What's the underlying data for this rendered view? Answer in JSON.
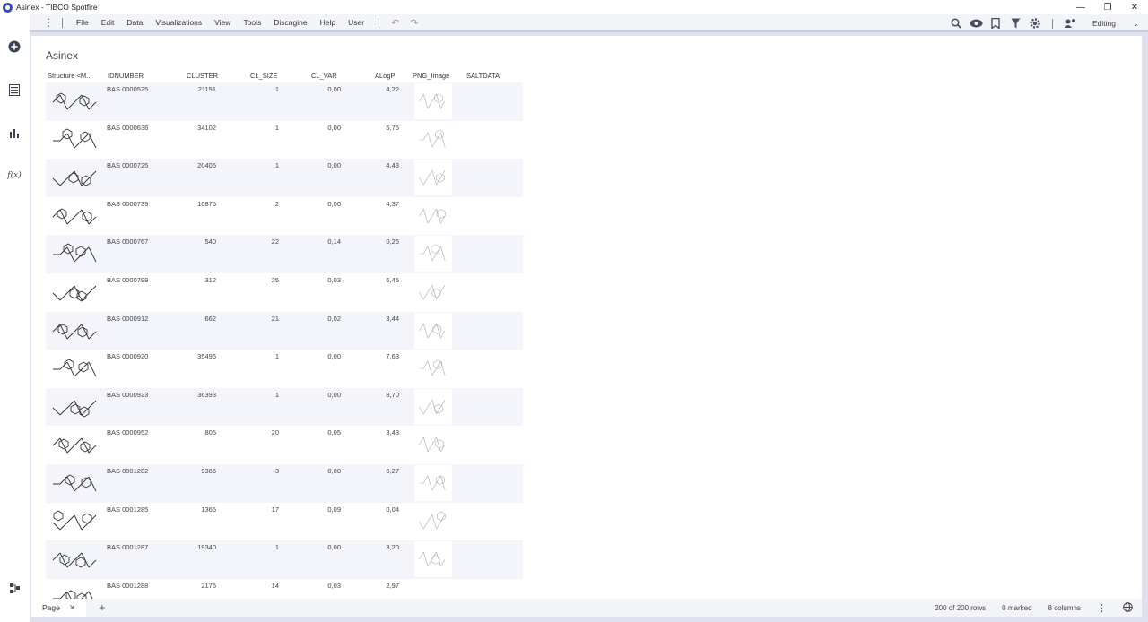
{
  "window": {
    "title": "Asinex - TIBCO Spotfire",
    "controls": [
      "—",
      "❐",
      "✕"
    ]
  },
  "leftbar": [
    {
      "name": "add-data-icon",
      "glyph": "⊕"
    },
    {
      "name": "data-canvas-icon",
      "glyph": "☰"
    },
    {
      "name": "visualizations-icon",
      "glyph": "▮"
    },
    {
      "name": "expression-icon",
      "glyph": "f(x)"
    },
    {
      "name": "data-flow-icon",
      "glyph": "⧉"
    }
  ],
  "menu": {
    "items": [
      "File",
      "Edit",
      "Data",
      "Visualizations",
      "View",
      "Tools",
      "Discngine",
      "Help",
      "User"
    ],
    "undo": "↶",
    "redo": "↷",
    "mode": "Editing"
  },
  "toolbar_icons": [
    "search-icon",
    "eye-icon",
    "bookmark-icon",
    "filter-icon",
    "gear-icon",
    "collaboration-icon"
  ],
  "viz": {
    "title": "Asinex",
    "columns": [
      "Structure <M...",
      "IDNUMBER",
      "CLUSTER",
      "CL_SIZE",
      "CL_VAR",
      "ALogP",
      "PNG_Image",
      "SALTDATA"
    ],
    "rows": [
      {
        "id": "BAS 0000525",
        "cluster": "21151",
        "cl_size": "1",
        "cl_var": "0,00",
        "alogp": "4,22"
      },
      {
        "id": "BAS 0000636",
        "cluster": "34102",
        "cl_size": "1",
        "cl_var": "0,00",
        "alogp": "5,75"
      },
      {
        "id": "BAS 0000725",
        "cluster": "20405",
        "cl_size": "1",
        "cl_var": "0,00",
        "alogp": "4,43"
      },
      {
        "id": "BAS 0000739",
        "cluster": "10875",
        "cl_size": "2",
        "cl_var": "0,00",
        "alogp": "4,37"
      },
      {
        "id": "BAS 0000767",
        "cluster": "540",
        "cl_size": "22",
        "cl_var": "0,14",
        "alogp": "0,26"
      },
      {
        "id": "BAS 0000799",
        "cluster": "312",
        "cl_size": "25",
        "cl_var": "0,03",
        "alogp": "6,45"
      },
      {
        "id": "BAS 0000912",
        "cluster": "662",
        "cl_size": "21",
        "cl_var": "0,02",
        "alogp": "3,44"
      },
      {
        "id": "BAS 0000920",
        "cluster": "35496",
        "cl_size": "1",
        "cl_var": "0,00",
        "alogp": "7,63"
      },
      {
        "id": "BAS 0000923",
        "cluster": "36393",
        "cl_size": "1",
        "cl_var": "0,00",
        "alogp": "8,70"
      },
      {
        "id": "BAS 0000952",
        "cluster": "805",
        "cl_size": "20",
        "cl_var": "0,05",
        "alogp": "3,43"
      },
      {
        "id": "BAS 0001282",
        "cluster": "9366",
        "cl_size": "3",
        "cl_var": "0,00",
        "alogp": "6,27"
      },
      {
        "id": "BAS 0001285",
        "cluster": "1365",
        "cl_size": "17",
        "cl_var": "0,09",
        "alogp": "0,04"
      },
      {
        "id": "BAS 0001287",
        "cluster": "19340",
        "cl_size": "1",
        "cl_var": "0,00",
        "alogp": "3,20"
      },
      {
        "id": "BAS 0001288",
        "cluster": "2175",
        "cl_size": "14",
        "cl_var": "0,03",
        "alogp": "2,97"
      }
    ]
  },
  "status": {
    "page_tab": "Page",
    "close": "✕",
    "add": "+",
    "rows_info": "200 of 200 rows",
    "marked": "0 marked",
    "columns": "8 columns"
  },
  "colors": {
    "frame": "#dfe2ee",
    "menubar": "#f3f4f8",
    "alt_row": "#f4f5fa",
    "accent": "#3b4fb8"
  }
}
